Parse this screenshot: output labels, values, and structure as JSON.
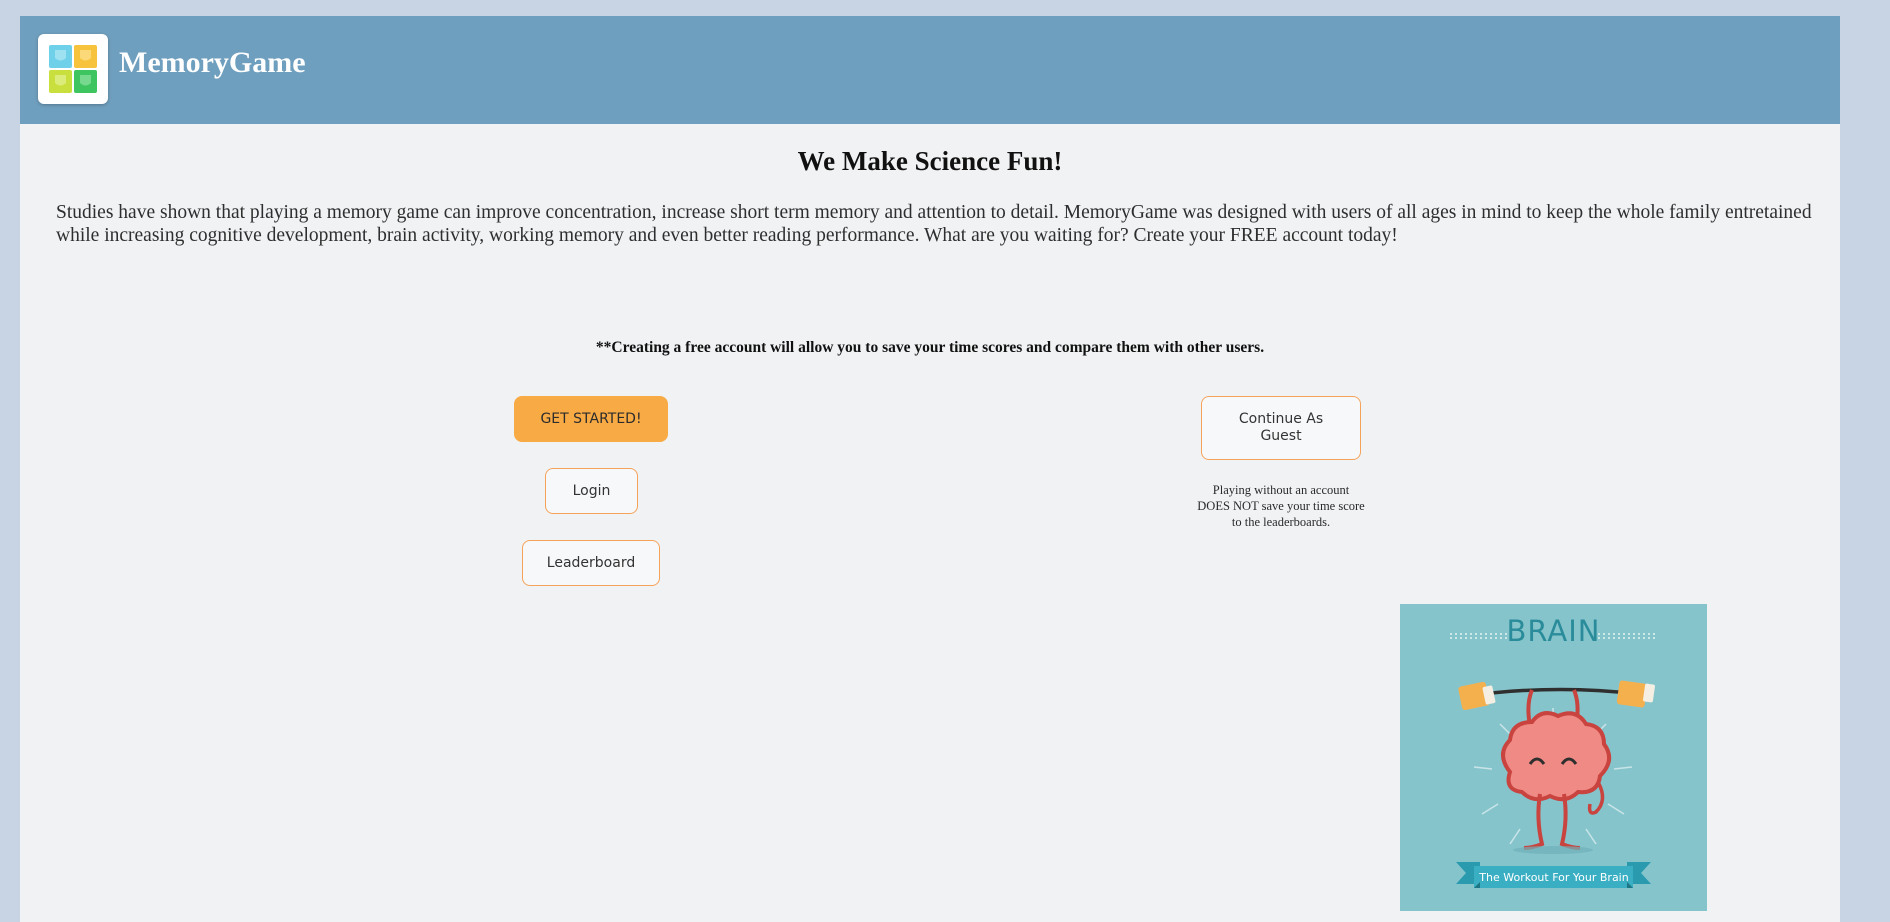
{
  "header": {
    "app_title": "MemoryGame",
    "logo_icon": "four-tile-grid-icon",
    "background_color": "#6f9fbe"
  },
  "main": {
    "headline": "We Make Science Fun!",
    "intro": "Studies have shown that playing a memory game can improve concentration, increase short term memory and attention to detail. MemoryGame was designed with users of all ages in mind to keep the whole family entretained while increasing cognitive development, brain activity, working memory and even better reading performance. What are you waiting for? Create your FREE account today!",
    "account_note": "**Creating a free account will allow you to save your time scores and compare them with other users."
  },
  "actions": {
    "get_started_label": "GET STARTED!",
    "login_label": "Login",
    "leaderboard_label": "Leaderboard",
    "guest_label": "Continue As Guest",
    "guest_note": "Playing without an account DOES NOT save your time score to the leaderboards."
  },
  "brain_image": {
    "title": "BRAIN",
    "tagline": "The Workout For Your Brain",
    "background_color": "#86c4cc"
  },
  "colors": {
    "accent_orange": "#f8ab45",
    "button_border": "#f5a35a",
    "page_background": "#f0f2f4",
    "outer_background": "#c8d4e3"
  }
}
